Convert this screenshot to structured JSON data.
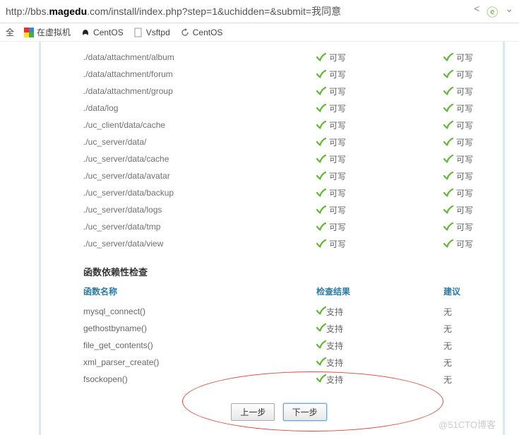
{
  "url": {
    "prefix": "http://bbs.",
    "domain": "magedu",
    "suffix": ".com/install/index.php?step=1&uchidden=&submit=我同意"
  },
  "bookmarks": {
    "safe": "全",
    "vm": "在虚拟机",
    "centos1": "CentOS",
    "vsftpd": "Vsftpd",
    "centos2": "CentOS"
  },
  "perm": {
    "status_writable": "可写",
    "rows": [
      "./data/attachment/album",
      "./data/attachment/forum",
      "./data/attachment/group",
      "./data/log",
      "./uc_client/data/cache",
      "./uc_server/data/",
      "./uc_server/data/cache",
      "./uc_server/data/avatar",
      "./uc_server/data/backup",
      "./uc_server/data/logs",
      "./uc_server/data/tmp",
      "./uc_server/data/view"
    ]
  },
  "func": {
    "section_title": "函数依赖性检查",
    "header_name": "函数名称",
    "header_result": "检查结果",
    "header_suggest": "建议",
    "result_ok": "支持",
    "suggest_none": "无",
    "rows": [
      "mysql_connect()",
      "gethostbyname()",
      "file_get_contents()",
      "xml_parser_create()",
      "fsockopen()"
    ]
  },
  "buttons": {
    "prev": "上一步",
    "next": "下一步"
  },
  "watermark": "@51CTO博客"
}
